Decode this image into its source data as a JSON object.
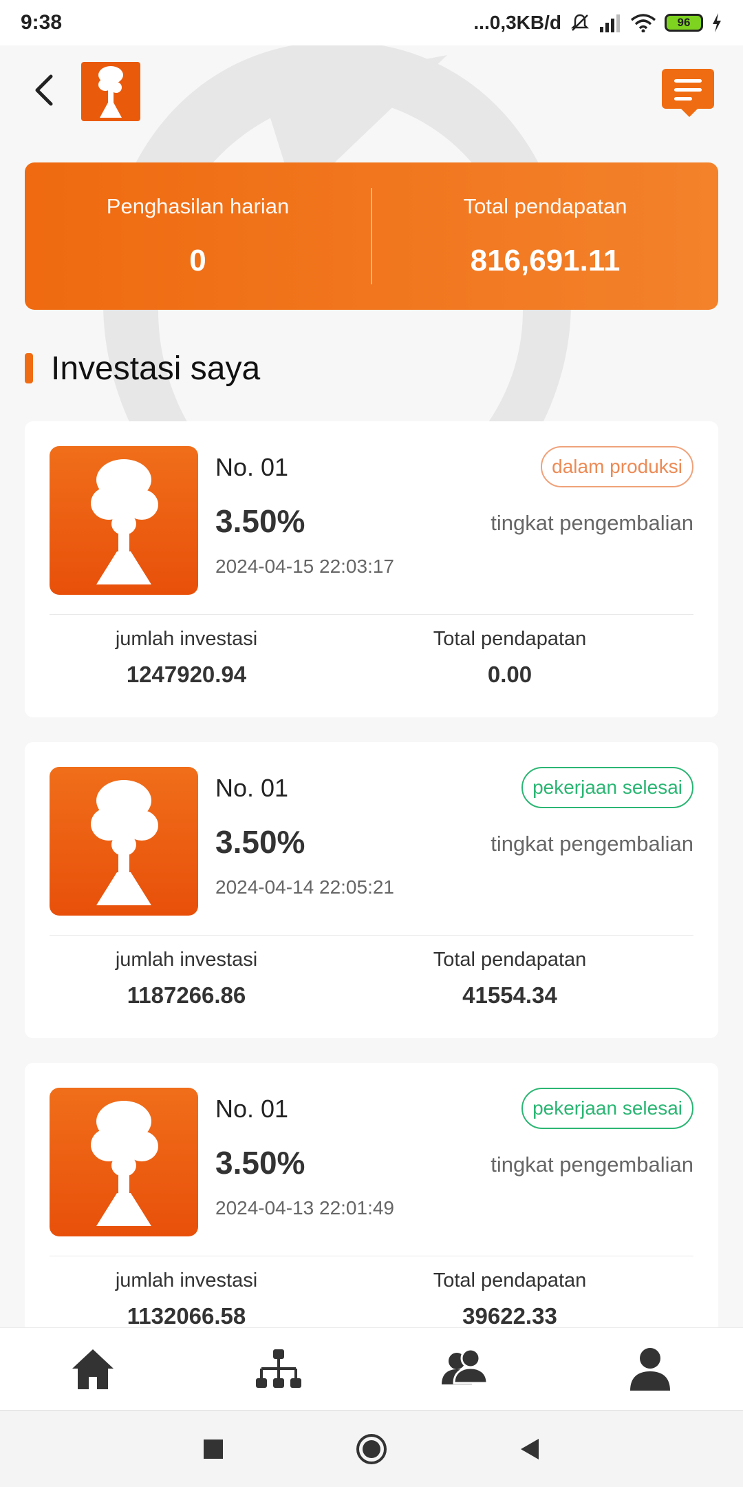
{
  "status_bar": {
    "time": "9:38",
    "network_speed": "...0,3KB/d",
    "battery": "96"
  },
  "summary": {
    "daily_label": "Penghasilan harian",
    "daily_value": "0",
    "total_label": "Total pendapatan",
    "total_value": "816,691.11"
  },
  "section": {
    "title": "Investasi saya"
  },
  "investments": [
    {
      "name": "No. 01",
      "rate": "3.50%",
      "rate_label": "tingkat pengembalian",
      "date": "2024-04-15 22:03:17",
      "status": "dalam produksi",
      "amount_label": "jumlah investasi",
      "amount": "1247920.94",
      "income_label": "Total pendapatan",
      "income": "0.00"
    },
    {
      "name": "No. 01",
      "rate": "3.50%",
      "rate_label": "tingkat pengembalian",
      "date": "2024-04-14 22:05:21",
      "status": "pekerjaan selesai",
      "amount_label": "jumlah investasi",
      "amount": "1187266.86",
      "income_label": "Total pendapatan",
      "income": "41554.34"
    },
    {
      "name": "No. 01",
      "rate": "3.50%",
      "rate_label": "tingkat pengembalian",
      "date": "2024-04-13 22:01:49",
      "status": "pekerjaan selesai",
      "amount_label": "jumlah investasi",
      "amount": "1132066.58",
      "income_label": "Total pendapatan",
      "income": "39622.33"
    }
  ],
  "bottom_nav": {
    "items": [
      "home-icon",
      "team-tree-icon",
      "group-icon",
      "user-icon"
    ]
  },
  "colors": {
    "accent": "#f06c12",
    "badge_orange": "#ec8a55",
    "badge_green": "#2bb673"
  }
}
